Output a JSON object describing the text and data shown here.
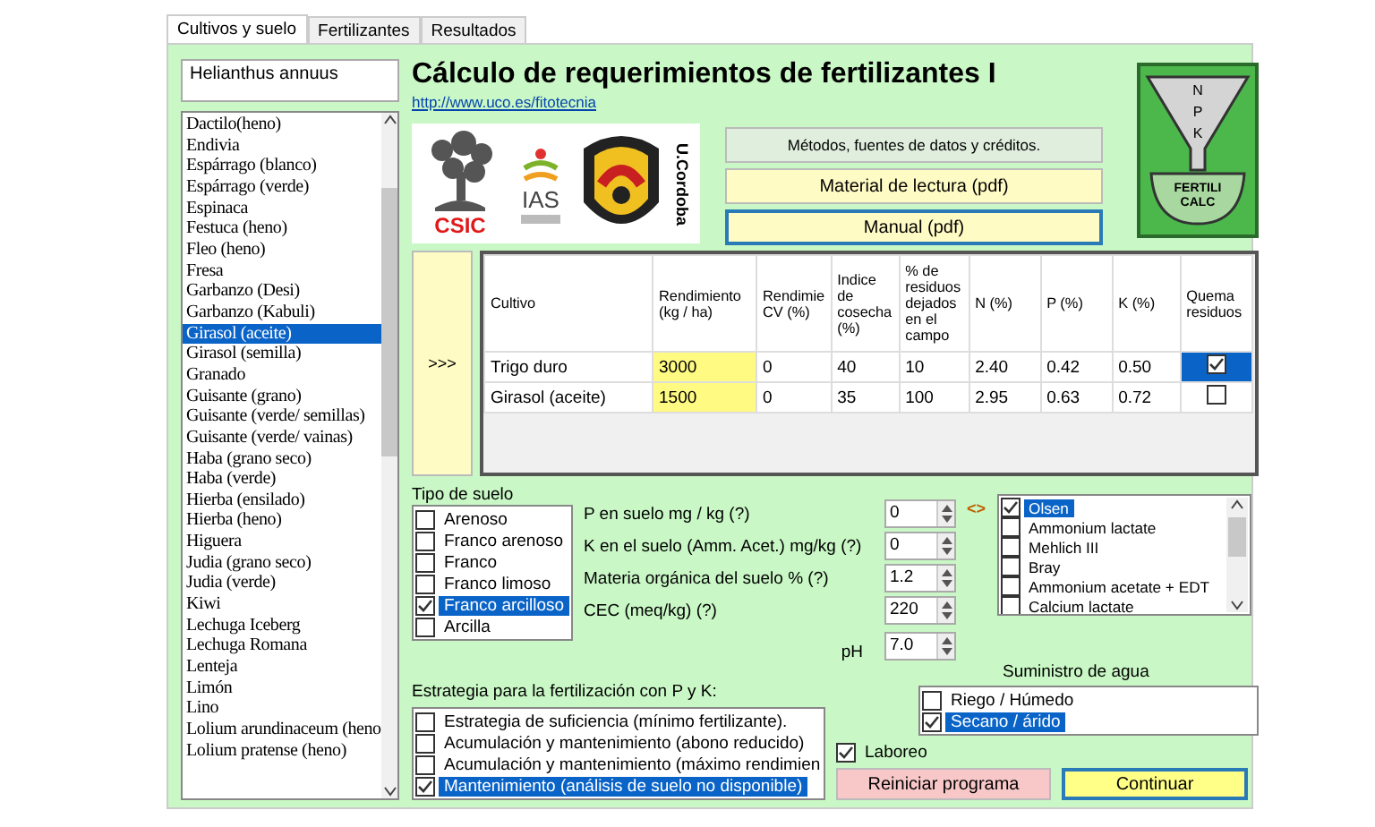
{
  "tabs": [
    {
      "label": "Cultivos y suelo",
      "selected": true
    },
    {
      "label": "Fertilizantes",
      "selected": false
    },
    {
      "label": "Resultados",
      "selected": false
    }
  ],
  "species_name": "Helianthus annuus",
  "crop_list": [
    {
      "label": "Dactilo(heno)",
      "selected": false
    },
    {
      "label": "Endivia",
      "selected": false
    },
    {
      "label": "Espárrago (blanco)",
      "selected": false
    },
    {
      "label": "Espárrago (verde)",
      "selected": false
    },
    {
      "label": "Espinaca",
      "selected": false
    },
    {
      "label": "Festuca (heno)",
      "selected": false
    },
    {
      "label": "Fleo (heno)",
      "selected": false
    },
    {
      "label": "Fresa",
      "selected": false
    },
    {
      "label": "Garbanzo (Desi)",
      "selected": false
    },
    {
      "label": "Garbanzo (Kabuli)",
      "selected": false
    },
    {
      "label": "Girasol (aceite)",
      "selected": true
    },
    {
      "label": "Girasol (semilla)",
      "selected": false
    },
    {
      "label": "Granado",
      "selected": false
    },
    {
      "label": "Guisante (grano)",
      "selected": false
    },
    {
      "label": "Guisante (verde/ semillas)",
      "selected": false
    },
    {
      "label": "Guisante (verde/ vainas)",
      "selected": false
    },
    {
      "label": "Haba (grano seco)",
      "selected": false
    },
    {
      "label": "Haba (verde)",
      "selected": false
    },
    {
      "label": "Hierba (ensilado)",
      "selected": false
    },
    {
      "label": "Hierba (heno)",
      "selected": false
    },
    {
      "label": "Higuera",
      "selected": false
    },
    {
      "label": "Judia (grano seco)",
      "selected": false
    },
    {
      "label": "Judia (verde)",
      "selected": false
    },
    {
      "label": "Kiwi",
      "selected": false
    },
    {
      "label": "Lechuga Iceberg",
      "selected": false
    },
    {
      "label": "Lechuga Romana",
      "selected": false
    },
    {
      "label": "Lenteja",
      "selected": false
    },
    {
      "label": "Limón",
      "selected": false
    },
    {
      "label": "Lino",
      "selected": false
    },
    {
      "label": "Lolium arundinaceum (heno",
      "selected": false
    },
    {
      "label": "Lolium pratense (heno)",
      "selected": false
    }
  ],
  "title": "Cálculo de requerimientos de fertilizantes I",
  "link": "http://www.uco.es/fitotecnia",
  "logos": {
    "csic": "CSIC",
    "ias": "IAS",
    "cordoba": "U.Cordoba",
    "npk": [
      "N",
      "P",
      "K"
    ],
    "fertili": "FERTILI",
    "calc": "CALC"
  },
  "info_buttons": [
    {
      "label": "Métodos, fuentes de datos y créditos.",
      "kind": "neutral",
      "focused": false
    },
    {
      "label": "Material de lectura (pdf)",
      "kind": "highlight",
      "focused": false
    },
    {
      "label": "Manual (pdf)",
      "kind": "highlight",
      "focused": true
    }
  ],
  "add_button": ">>>",
  "table": {
    "columns": [
      {
        "label": "Cultivo",
        "highlight": false
      },
      {
        "label": "Rendimiento (kg / ha)",
        "highlight": true
      },
      {
        "label": "Rendimie CV (%)",
        "highlight": false
      },
      {
        "label": "Indice de cosecha (%)",
        "highlight": false
      },
      {
        "label": "% de residuos dejados en el campo",
        "highlight": false
      },
      {
        "label": "N (%)",
        "highlight": false
      },
      {
        "label": "P (%)",
        "highlight": false
      },
      {
        "label": "K (%)",
        "highlight": false
      },
      {
        "label": "Quema residuos",
        "highlight": false
      }
    ],
    "rows": [
      {
        "cells": [
          "Trigo duro",
          "3000",
          "0",
          "40",
          "10",
          "2.40",
          "0.42",
          "0.50"
        ],
        "checked": true,
        "selected": true
      },
      {
        "cells": [
          "Girasol (aceite)",
          "1500",
          "0",
          "35",
          "100",
          "2.95",
          "0.63",
          "0.72"
        ],
        "checked": false,
        "selected": false
      }
    ]
  },
  "soil_type": {
    "label": "Tipo de suelo",
    "items": [
      {
        "label": "Arenoso",
        "checked": false,
        "selected": false
      },
      {
        "label": "Franco arenoso",
        "checked": false,
        "selected": false
      },
      {
        "label": "Franco",
        "checked": false,
        "selected": false
      },
      {
        "label": "Franco limoso",
        "checked": false,
        "selected": false
      },
      {
        "label": "Franco arcilloso",
        "checked": true,
        "selected": true
      },
      {
        "label": "Arcilla",
        "checked": false,
        "selected": false
      }
    ]
  },
  "soil_params": [
    {
      "label": "P en suelo mg / kg (?)",
      "value": "0"
    },
    {
      "label": "K en el suelo (Amm. Acet.) mg/kg (?)",
      "value": "0"
    },
    {
      "label": "Materia orgánica del suelo % (?)",
      "value": "1.2"
    },
    {
      "label": "CEC (meq/kg) (?)",
      "value": "220"
    },
    {
      "label": "pH",
      "value": "7.0"
    }
  ],
  "method_link": "<>",
  "methods": [
    {
      "label": "Olsen",
      "checked": true,
      "selected": true
    },
    {
      "label": "Ammonium lactate",
      "checked": false,
      "selected": false
    },
    {
      "label": "Mehlich III",
      "checked": false,
      "selected": false
    },
    {
      "label": "Bray",
      "checked": false,
      "selected": false
    },
    {
      "label": "Ammonium acetate + EDT",
      "checked": false,
      "selected": false
    },
    {
      "label": "Calcium lactate",
      "checked": false,
      "selected": false
    }
  ],
  "water": {
    "label": "Suministro de agua",
    "items": [
      {
        "label": "Riego / Húmedo",
        "checked": false,
        "selected": false
      },
      {
        "label": "Secano / árido",
        "checked": true,
        "selected": true
      }
    ]
  },
  "strategy": {
    "label": "Estrategia para la fertilización con P y K:",
    "items": [
      {
        "label": "Estrategia de suficiencia (mínimo fertilizante).",
        "checked": false,
        "selected": false
      },
      {
        "label": "Acumulación y mantenimiento (abono reducido)",
        "checked": false,
        "selected": false
      },
      {
        "label": "Acumulación y mantenimiento (máximo rendimien",
        "checked": false,
        "selected": false
      },
      {
        "label": "Mantenimiento (análisis de suelo no disponible)",
        "checked": true,
        "selected": true
      }
    ]
  },
  "tillage": {
    "label": "Laboreo",
    "checked": true
  },
  "actions": [
    {
      "label": "Reiniciar programa",
      "kind": "reset"
    },
    {
      "label": "Continuar",
      "kind": "primary"
    }
  ]
}
